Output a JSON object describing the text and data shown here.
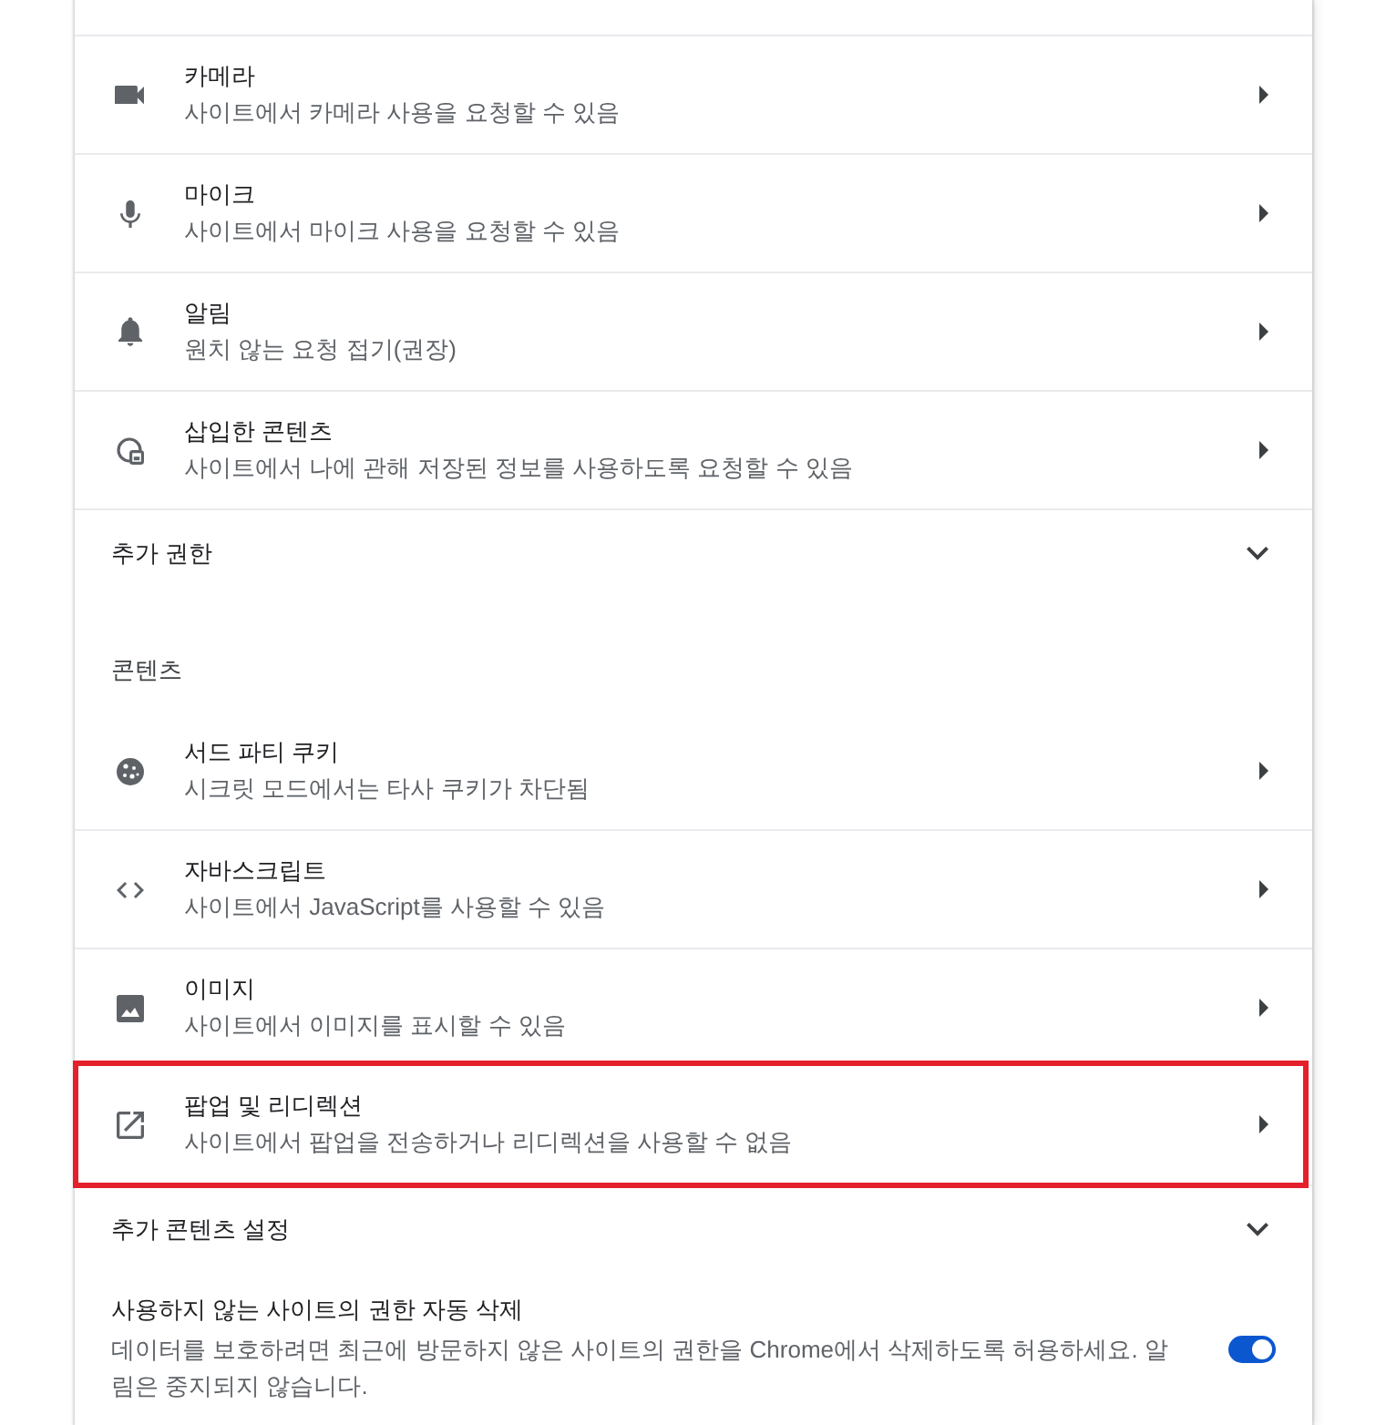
{
  "permissions": {
    "items": [
      {
        "kind": "camera",
        "title": "카메라",
        "description": "사이트에서 카메라 사용을 요청할 수 있음",
        "highlighted": false
      },
      {
        "kind": "microphone",
        "title": "마이크",
        "description": "사이트에서 마이크 사용을 요청할 수 있음",
        "highlighted": false
      },
      {
        "kind": "notifications",
        "title": "알림",
        "description": "원치 않는 요청 접기(권장)",
        "highlighted": false
      },
      {
        "kind": "embedded",
        "title": "삽입한 콘텐츠",
        "description": "사이트에서 나에 관해 저장된 정보를 사용하도록 요청할 수 있음",
        "highlighted": false
      }
    ],
    "more": {
      "label": "추가 권한",
      "expanded": false
    }
  },
  "content": {
    "heading": "콘텐츠",
    "items": [
      {
        "kind": "cookies",
        "title": "서드 파티 쿠키",
        "description": "시크릿 모드에서는 타사 쿠키가 차단됨",
        "highlighted": false
      },
      {
        "kind": "javascript",
        "title": "자바스크립트",
        "description": "사이트에서 JavaScript를 사용할 수 있음",
        "highlighted": false
      },
      {
        "kind": "images",
        "title": "이미지",
        "description": "사이트에서 이미지를 표시할 수 있음",
        "highlighted": false
      },
      {
        "kind": "popups",
        "title": "팝업 및 리디렉션",
        "description": "사이트에서 팝업을 전송하거나 리디렉션을 사용할 수 없음",
        "highlighted": true
      }
    ],
    "more": {
      "label": "추가 콘텐츠 설정",
      "expanded": false
    }
  },
  "auto_revoke": {
    "title": "사용하지 않는 사이트의 권한 자동 삭제",
    "description": "데이터를 보호하려면 최근에 방문하지 않은 사이트의 권한을 Chrome에서 삭제하도록 허용하세요. 알림은 중지되지 않습니다.",
    "on": true
  }
}
